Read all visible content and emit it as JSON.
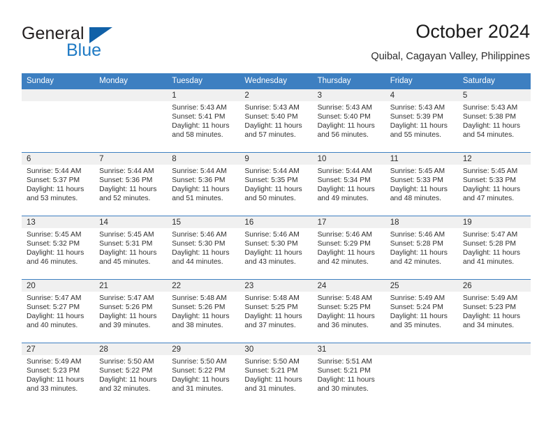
{
  "brand": {
    "word_general": "General",
    "word_blue": "Blue",
    "triangle_color": "#1161a8",
    "blue_color": "#1f7ac4"
  },
  "header": {
    "title": "October 2024",
    "location": "Quibal, Cagayan Valley, Philippines"
  },
  "theme": {
    "header_blue": "#3d7fc1",
    "date_band_gray": "#f0f0f0"
  },
  "weekdays": [
    "Sunday",
    "Monday",
    "Tuesday",
    "Wednesday",
    "Thursday",
    "Friday",
    "Saturday"
  ],
  "weeks": [
    [
      {
        "day": "",
        "empty": true
      },
      {
        "day": "",
        "empty": true
      },
      {
        "day": "1",
        "sunrise": "Sunrise: 5:43 AM",
        "sunset": "Sunset: 5:41 PM",
        "daylight": "Daylight: 11 hours and 58 minutes."
      },
      {
        "day": "2",
        "sunrise": "Sunrise: 5:43 AM",
        "sunset": "Sunset: 5:40 PM",
        "daylight": "Daylight: 11 hours and 57 minutes."
      },
      {
        "day": "3",
        "sunrise": "Sunrise: 5:43 AM",
        "sunset": "Sunset: 5:40 PM",
        "daylight": "Daylight: 11 hours and 56 minutes."
      },
      {
        "day": "4",
        "sunrise": "Sunrise: 5:43 AM",
        "sunset": "Sunset: 5:39 PM",
        "daylight": "Daylight: 11 hours and 55 minutes."
      },
      {
        "day": "5",
        "sunrise": "Sunrise: 5:43 AM",
        "sunset": "Sunset: 5:38 PM",
        "daylight": "Daylight: 11 hours and 54 minutes."
      }
    ],
    [
      {
        "day": "6",
        "sunrise": "Sunrise: 5:44 AM",
        "sunset": "Sunset: 5:37 PM",
        "daylight": "Daylight: 11 hours and 53 minutes."
      },
      {
        "day": "7",
        "sunrise": "Sunrise: 5:44 AM",
        "sunset": "Sunset: 5:36 PM",
        "daylight": "Daylight: 11 hours and 52 minutes."
      },
      {
        "day": "8",
        "sunrise": "Sunrise: 5:44 AM",
        "sunset": "Sunset: 5:36 PM",
        "daylight": "Daylight: 11 hours and 51 minutes."
      },
      {
        "day": "9",
        "sunrise": "Sunrise: 5:44 AM",
        "sunset": "Sunset: 5:35 PM",
        "daylight": "Daylight: 11 hours and 50 minutes."
      },
      {
        "day": "10",
        "sunrise": "Sunrise: 5:44 AM",
        "sunset": "Sunset: 5:34 PM",
        "daylight": "Daylight: 11 hours and 49 minutes."
      },
      {
        "day": "11",
        "sunrise": "Sunrise: 5:45 AM",
        "sunset": "Sunset: 5:33 PM",
        "daylight": "Daylight: 11 hours and 48 minutes."
      },
      {
        "day": "12",
        "sunrise": "Sunrise: 5:45 AM",
        "sunset": "Sunset: 5:33 PM",
        "daylight": "Daylight: 11 hours and 47 minutes."
      }
    ],
    [
      {
        "day": "13",
        "sunrise": "Sunrise: 5:45 AM",
        "sunset": "Sunset: 5:32 PM",
        "daylight": "Daylight: 11 hours and 46 minutes."
      },
      {
        "day": "14",
        "sunrise": "Sunrise: 5:45 AM",
        "sunset": "Sunset: 5:31 PM",
        "daylight": "Daylight: 11 hours and 45 minutes."
      },
      {
        "day": "15",
        "sunrise": "Sunrise: 5:46 AM",
        "sunset": "Sunset: 5:30 PM",
        "daylight": "Daylight: 11 hours and 44 minutes."
      },
      {
        "day": "16",
        "sunrise": "Sunrise: 5:46 AM",
        "sunset": "Sunset: 5:30 PM",
        "daylight": "Daylight: 11 hours and 43 minutes."
      },
      {
        "day": "17",
        "sunrise": "Sunrise: 5:46 AM",
        "sunset": "Sunset: 5:29 PM",
        "daylight": "Daylight: 11 hours and 42 minutes."
      },
      {
        "day": "18",
        "sunrise": "Sunrise: 5:46 AM",
        "sunset": "Sunset: 5:28 PM",
        "daylight": "Daylight: 11 hours and 42 minutes."
      },
      {
        "day": "19",
        "sunrise": "Sunrise: 5:47 AM",
        "sunset": "Sunset: 5:28 PM",
        "daylight": "Daylight: 11 hours and 41 minutes."
      }
    ],
    [
      {
        "day": "20",
        "sunrise": "Sunrise: 5:47 AM",
        "sunset": "Sunset: 5:27 PM",
        "daylight": "Daylight: 11 hours and 40 minutes."
      },
      {
        "day": "21",
        "sunrise": "Sunrise: 5:47 AM",
        "sunset": "Sunset: 5:26 PM",
        "daylight": "Daylight: 11 hours and 39 minutes."
      },
      {
        "day": "22",
        "sunrise": "Sunrise: 5:48 AM",
        "sunset": "Sunset: 5:26 PM",
        "daylight": "Daylight: 11 hours and 38 minutes."
      },
      {
        "day": "23",
        "sunrise": "Sunrise: 5:48 AM",
        "sunset": "Sunset: 5:25 PM",
        "daylight": "Daylight: 11 hours and 37 minutes."
      },
      {
        "day": "24",
        "sunrise": "Sunrise: 5:48 AM",
        "sunset": "Sunset: 5:25 PM",
        "daylight": "Daylight: 11 hours and 36 minutes."
      },
      {
        "day": "25",
        "sunrise": "Sunrise: 5:49 AM",
        "sunset": "Sunset: 5:24 PM",
        "daylight": "Daylight: 11 hours and 35 minutes."
      },
      {
        "day": "26",
        "sunrise": "Sunrise: 5:49 AM",
        "sunset": "Sunset: 5:23 PM",
        "daylight": "Daylight: 11 hours and 34 minutes."
      }
    ],
    [
      {
        "day": "27",
        "sunrise": "Sunrise: 5:49 AM",
        "sunset": "Sunset: 5:23 PM",
        "daylight": "Daylight: 11 hours and 33 minutes."
      },
      {
        "day": "28",
        "sunrise": "Sunrise: 5:50 AM",
        "sunset": "Sunset: 5:22 PM",
        "daylight": "Daylight: 11 hours and 32 minutes."
      },
      {
        "day": "29",
        "sunrise": "Sunrise: 5:50 AM",
        "sunset": "Sunset: 5:22 PM",
        "daylight": "Daylight: 11 hours and 31 minutes."
      },
      {
        "day": "30",
        "sunrise": "Sunrise: 5:50 AM",
        "sunset": "Sunset: 5:21 PM",
        "daylight": "Daylight: 11 hours and 31 minutes."
      },
      {
        "day": "31",
        "sunrise": "Sunrise: 5:51 AM",
        "sunset": "Sunset: 5:21 PM",
        "daylight": "Daylight: 11 hours and 30 minutes."
      },
      {
        "day": "",
        "empty": true
      },
      {
        "day": "",
        "empty": true
      }
    ]
  ]
}
